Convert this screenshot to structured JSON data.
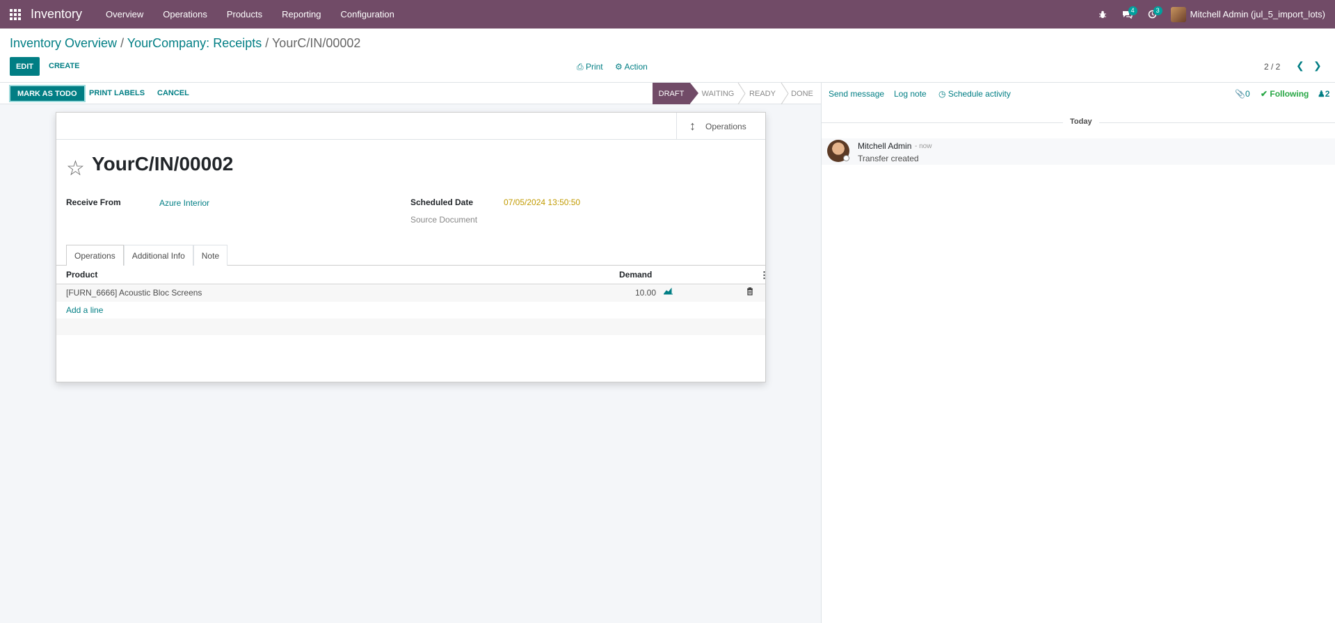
{
  "navbar": {
    "app_name": "Inventory",
    "menu": [
      "Overview",
      "Operations",
      "Products",
      "Reporting",
      "Configuration"
    ],
    "messages_count": "4",
    "activities_count": "3",
    "user": "Mitchell Admin (jul_5_import_lots)"
  },
  "breadcrumb": {
    "item1": "Inventory Overview",
    "item2": "YourCompany: Receipts",
    "current": "YourC/IN/00002",
    "sep": "/"
  },
  "control": {
    "edit": "EDIT",
    "create": "CREATE",
    "print": "Print",
    "action": "Action",
    "pager": "2 / 2"
  },
  "statusbar": {
    "mark_todo": "MARK AS TODO",
    "print_labels": "PRINT LABELS",
    "cancel": "CANCEL",
    "stages": [
      "DRAFT",
      "WAITING",
      "READY",
      "DONE"
    ],
    "active_stage": "DRAFT"
  },
  "form": {
    "smart_button": "Operations",
    "title": "YourC/IN/00002",
    "receive_from_label": "Receive From",
    "receive_from": "Azure Interior",
    "scheduled_date_label": "Scheduled Date",
    "scheduled_date": "07/05/2024 13:50:50",
    "source_document_label": "Source Document",
    "tabs": [
      "Operations",
      "Additional Info",
      "Note"
    ],
    "columns": {
      "product": "Product",
      "demand": "Demand"
    },
    "lines": [
      {
        "product": "[FURN_6666] Acoustic Bloc Screens",
        "demand": "10.00"
      }
    ],
    "add_line": "Add a line"
  },
  "chatter": {
    "send_message": "Send message",
    "log_note": "Log note",
    "schedule_activity": "Schedule activity",
    "attachments": "0",
    "following": "Following",
    "followers": "2",
    "today": "Today",
    "message": {
      "author": "Mitchell Admin",
      "time": "- now",
      "body": "Transfer created"
    }
  },
  "colors": {
    "brand": "#714b67",
    "accent": "#017e84",
    "following": "#28a745",
    "date": "#c19a00"
  }
}
